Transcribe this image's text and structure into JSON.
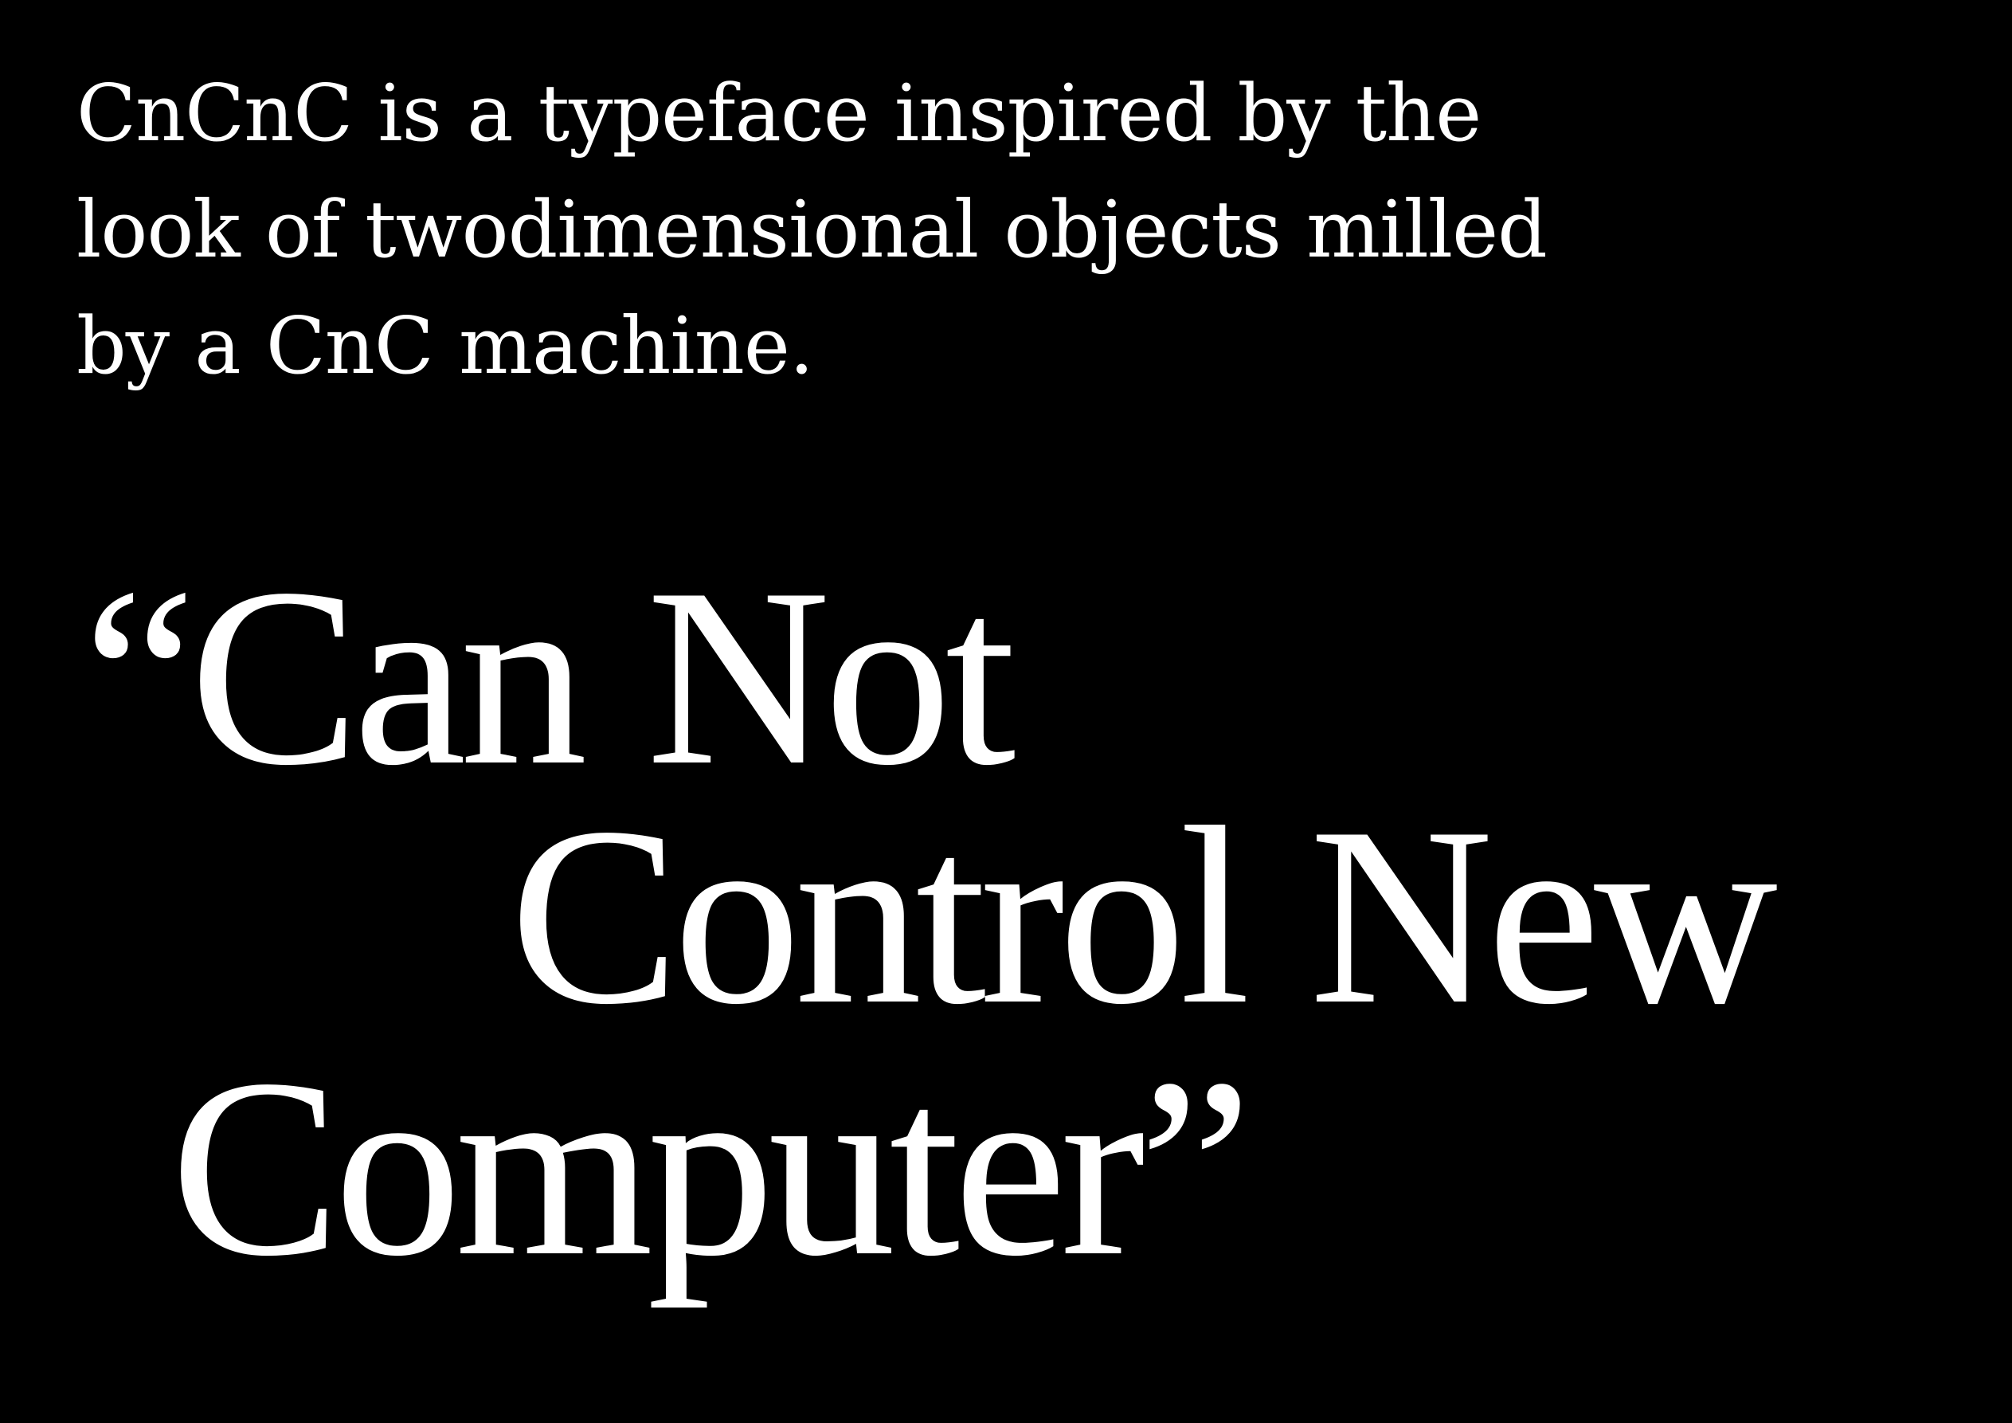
{
  "intro": {
    "lines": [
      "CnCnC is a typeface inspired by the",
      "look of twodimensional objects milled",
      "by a CnC machine."
    ]
  },
  "quote": {
    "lines": [
      "“Can Not",
      "Control New",
      "Computer”"
    ]
  },
  "colors": {
    "background": "#000000",
    "text": "#ffffff"
  }
}
